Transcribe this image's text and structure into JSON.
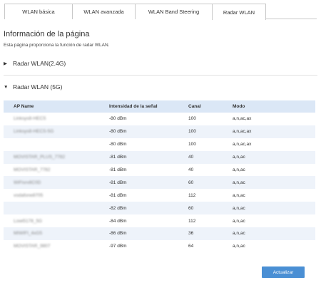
{
  "tabs": [
    {
      "label": "WLAN básica"
    },
    {
      "label": "WLAN avanzada"
    },
    {
      "label": "WLAN Band Steering"
    },
    {
      "label": "Radar WLAN"
    }
  ],
  "page": {
    "title": "Información de la página",
    "description": "Esta página proporciona la función de radar WLAN."
  },
  "sections": {
    "g24": {
      "label": "Radar WLAN(2.4G)",
      "icon": "triangle-right-icon"
    },
    "g5": {
      "label": "Radar WLAN (5G)",
      "icon": "triangle-down-icon"
    }
  },
  "table": {
    "headers": [
      "AP Name",
      "Intensidad de la señal",
      "Canal",
      "Modo"
    ],
    "rows": [
      [
        "Linksys8-HECS",
        "-80 dBm",
        "100",
        "a,n,ac,ax"
      ],
      [
        "Linksys8-HECS-5G",
        "-80 dBm",
        "100",
        "a,n,ac,ax"
      ],
      [
        "",
        "-80 dBm",
        "100",
        "a,n,ac,ax"
      ],
      [
        "MOVISTAR_PLUS_7782",
        "-81 dBm",
        "40",
        "a,n,ac"
      ],
      [
        "MOVISTAR_7782",
        "-81 dBm",
        "40",
        "a,n,ac"
      ],
      [
        "WiFisrv8C0D",
        "-81 dBm",
        "60",
        "a,n,ac"
      ],
      [
        "vodafone8705",
        "-81 dBm",
        "112",
        "a,n,ac"
      ],
      [
        "",
        "-82 dBm",
        "60",
        "a,n,ac"
      ],
      [
        "Lowi5178_5G",
        "-84 dBm",
        "112",
        "a,n,ac"
      ],
      [
        "MIWIFI_4xG5",
        "-86 dBm",
        "36",
        "a,n,ac"
      ],
      [
        "MOVISTAR_9807",
        "-97 dBm",
        "64",
        "a,n,ac"
      ]
    ]
  },
  "actions": {
    "refresh_label": "Actualizar"
  },
  "colors": {
    "header_bg": "#dbe7f6",
    "button_bg": "#4a8fd4"
  }
}
